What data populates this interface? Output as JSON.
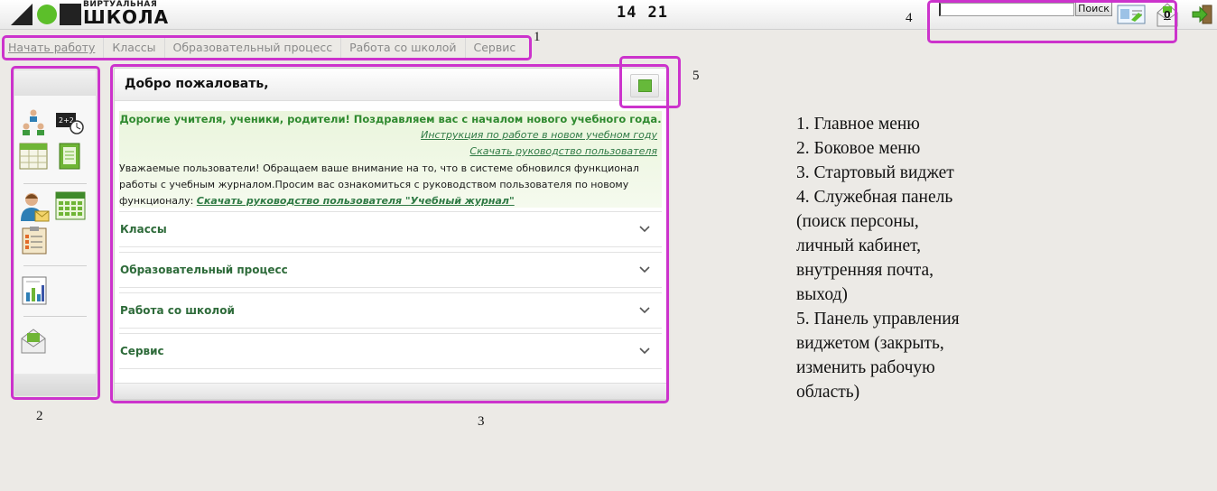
{
  "header": {
    "logo_top": "ВИРТУАЛЬНАЯ",
    "logo_main": "ШКОЛА",
    "clock_hours": "14",
    "clock_minutes": "21",
    "search_value": "",
    "search_button": "Поиск",
    "mail_count": "0",
    "icons": [
      "cabinet-icon",
      "mail-icon",
      "exit-icon"
    ]
  },
  "main_menu": {
    "items": [
      {
        "label": "Начать работу",
        "active": true
      },
      {
        "label": "Классы"
      },
      {
        "label": "Образовательный процесс"
      },
      {
        "label": "Работа со школой"
      },
      {
        "label": "Сервис"
      }
    ]
  },
  "sidebar": {
    "icons": [
      "users-icon",
      "schoolboard-clock-icon",
      "calendar-icon",
      "notebook-icon",
      "teacher-mail-icon",
      "grid-calendar-icon",
      "checklist-icon",
      "report-chart-icon",
      "envelope-icon"
    ]
  },
  "widget": {
    "title": "Добро пожаловать,",
    "greeting": "Дорогие учителя, ученики, родители! Поздравляем вас с началом нового учебного года.",
    "link_instruction": "Инструкция по работе в новом учебном году",
    "link_manual": "Скачать руководство пользователя",
    "notice_text": "Уважаемые пользователи! Обращаем ваше внимание на то, что в системе обновился функционал работы с учебным журналом.Просим вас ознакомиться с руководством пользователя по новому функционалу: ",
    "notice_link": "Скачать руководство пользователя \"Учебный журнал\"",
    "sections": [
      {
        "label": "Классы"
      },
      {
        "label": "Образовательный процесс"
      },
      {
        "label": "Работа со школой"
      },
      {
        "label": "Сервис"
      }
    ]
  },
  "annotations": {
    "n1": "1",
    "n2": "2",
    "n3": "3",
    "n4": "4",
    "n5": "5",
    "box_color": "#cc33cc",
    "legend": [
      "1. Главное меню",
      "2. Боковое меню",
      "3. Стартовый виджет",
      "4. Служебная панель",
      "(поиск персоны,",
      "личный кабинет,",
      "внутренняя почта,",
      "выход)",
      "5. Панель управления",
      "виджетом (закрыть,",
      "изменить рабочую",
      "область)"
    ]
  }
}
